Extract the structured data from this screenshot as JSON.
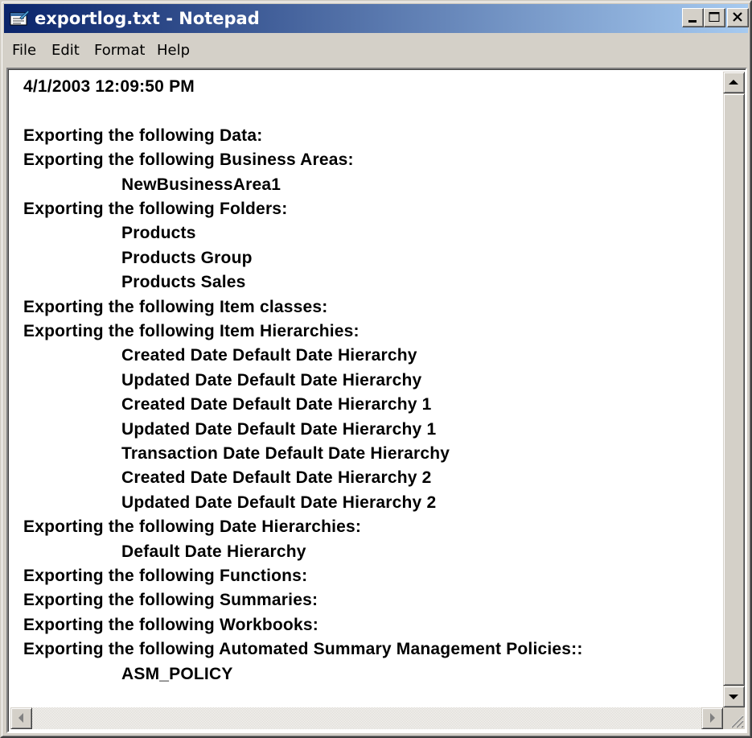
{
  "window": {
    "title": "exportlog.txt - Notepad",
    "icon": "notepad-icon",
    "controls": [
      "minimize-icon",
      "maximize-icon",
      "close-icon"
    ]
  },
  "menu": {
    "file": "File",
    "edit": "Edit",
    "format": "Format",
    "help": "Help"
  },
  "document": {
    "lines": [
      {
        "text": "4/1/2003 12:09:50 PM",
        "indent": false
      },
      {
        "text": "",
        "indent": false
      },
      {
        "text": "Exporting the following Data:",
        "indent": false
      },
      {
        "text": "Exporting the following Business Areas:",
        "indent": false
      },
      {
        "text": "NewBusinessArea1",
        "indent": true
      },
      {
        "text": "Exporting the following Folders:",
        "indent": false
      },
      {
        "text": "Products",
        "indent": true
      },
      {
        "text": "Products Group",
        "indent": true
      },
      {
        "text": "Products Sales",
        "indent": true
      },
      {
        "text": "Exporting the following Item classes:",
        "indent": false
      },
      {
        "text": "Exporting the following Item Hierarchies:",
        "indent": false
      },
      {
        "text": "Created Date Default Date Hierarchy",
        "indent": true
      },
      {
        "text": "Updated Date Default Date Hierarchy",
        "indent": true
      },
      {
        "text": "Created Date Default Date Hierarchy 1",
        "indent": true
      },
      {
        "text": "Updated Date Default Date Hierarchy 1",
        "indent": true
      },
      {
        "text": "Transaction Date Default Date Hierarchy",
        "indent": true
      },
      {
        "text": "Created Date Default Date Hierarchy 2",
        "indent": true
      },
      {
        "text": "Updated Date Default Date Hierarchy 2",
        "indent": true
      },
      {
        "text": "Exporting the following Date Hierarchies:",
        "indent": false
      },
      {
        "text": "Default Date Hierarchy",
        "indent": true
      },
      {
        "text": "Exporting the following Functions:",
        "indent": false
      },
      {
        "text": "Exporting the following Summaries:",
        "indent": false
      },
      {
        "text": "Exporting the following Workbooks:",
        "indent": false
      },
      {
        "text": "Exporting the following Automated Summary Management Policies::",
        "indent": false
      },
      {
        "text": "ASM_POLICY",
        "indent": true
      }
    ]
  },
  "colors": {
    "titlebar_start": "#0a246a",
    "titlebar_end": "#a6caf0",
    "chrome": "#d4d0c8"
  }
}
